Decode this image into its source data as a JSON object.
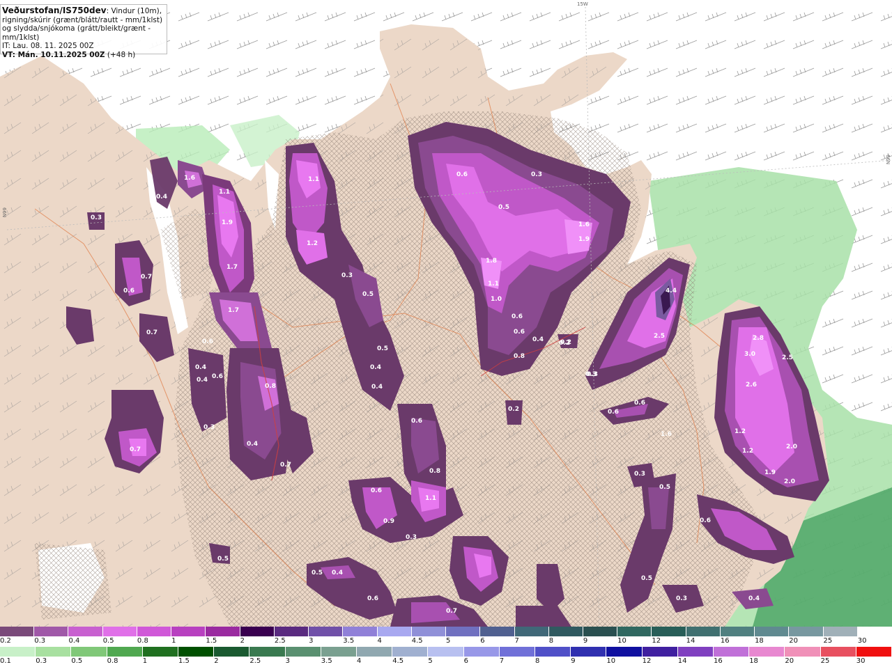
{
  "header": {
    "brand": "Veðurstofan/IS750dev",
    "description": ": Vindur (10m), rigning/skúrir (grænt/blátt/rautt - mm/1klst) og slydda/snjókoma (grátt/bleikt/grænt - mm/1klst)",
    "it_line": "IT: Lau. 08. 11. 2025 00Z",
    "vt_bold": "VT: Mán. 10.11.2025 00Z",
    "vt_extra": " (+48 h)"
  },
  "map_coords": {
    "top_lon": "15W",
    "right_lat": "66N",
    "left_lat": "66N"
  },
  "precip_values": [
    "1.6",
    "1.1",
    "0.4",
    "0.3",
    "1.9",
    "1.7",
    "0.4",
    "0.6",
    "1.7",
    "0.7",
    "1.1",
    "1.2",
    "0.3",
    "0.5",
    "0.8",
    "0.4",
    "0.7",
    "0.6",
    "0.7",
    "1.6",
    "1.9",
    "1.8",
    "1.1",
    "1.0",
    "0.6",
    "0.6",
    "0.8",
    "0.4",
    "0.2",
    "0.3",
    "4.4",
    "2.5",
    "0.6",
    "0.6",
    "2.8",
    "3.0",
    "2.5",
    "2.6",
    "1.2",
    "1.2",
    "2.0",
    "1.9",
    "2.0",
    "0.5",
    "0.6",
    "0.3",
    "0.4",
    "0.6",
    "0.4",
    "0.3",
    "0.8",
    "0.6",
    "0.5",
    "0.4",
    "0.3",
    "0.6",
    "0.9",
    "1.1",
    "0.6",
    "0.3",
    "0.5",
    "0.4",
    "0.5",
    "0.6",
    "0.7",
    "1.6",
    "0.2",
    "0.5",
    "0.3",
    "0.2",
    "0.7",
    "0.4",
    "0.5",
    "0.3"
  ],
  "legend_snow": {
    "labels": [
      "0.2",
      "0.3",
      "0.4",
      "0.5",
      "0.8",
      "1",
      "1.5",
      "2",
      "2.5",
      "3",
      "3.5",
      "4",
      "4.5",
      "5",
      "6",
      "7",
      "8",
      "9",
      "10",
      "12",
      "14",
      "16",
      "18",
      "20",
      "25",
      "30"
    ],
    "colors": [
      "#7a4a7a",
      "#a058a8",
      "#c860d0",
      "#e070e8",
      "#d058d8",
      "#b840c0",
      "#9a2aa0",
      "#3a0050",
      "#5a2a80",
      "#7050a8",
      "#9080d8",
      "#a8a8f0",
      "#9090d8",
      "#7070c0",
      "#506090",
      "#406878",
      "#305a60",
      "#2a5050",
      "#306860",
      "#285e58",
      "#407070",
      "#508080",
      "#608a90",
      "#7898a0",
      "#a0b0b8",
      "#ffffff"
    ]
  },
  "legend_rain": {
    "labels": [
      "0.1",
      "0.3",
      "0.5",
      "0.8",
      "1",
      "1.5",
      "2",
      "2.5",
      "3",
      "3.5",
      "4",
      "4.5",
      "5",
      "6",
      "7",
      "8",
      "9",
      "10",
      "12",
      "14",
      "16",
      "18",
      "20",
      "25",
      "30"
    ],
    "colors": [
      "#c8f0c8",
      "#a8e0a0",
      "#80c878",
      "#50a850",
      "#207020",
      "#005000",
      "#1a5a30",
      "#3a7a50",
      "#5a9070",
      "#7aa090",
      "#90a8b0",
      "#a0b0d0",
      "#b8c0f0",
      "#9898e8",
      "#7070d8",
      "#5050c8",
      "#3030b0",
      "#1010a0",
      "#4020a0",
      "#8040c0",
      "#c070d8",
      "#e888d0",
      "#f090b8",
      "#e85060",
      "#f01010"
    ]
  }
}
